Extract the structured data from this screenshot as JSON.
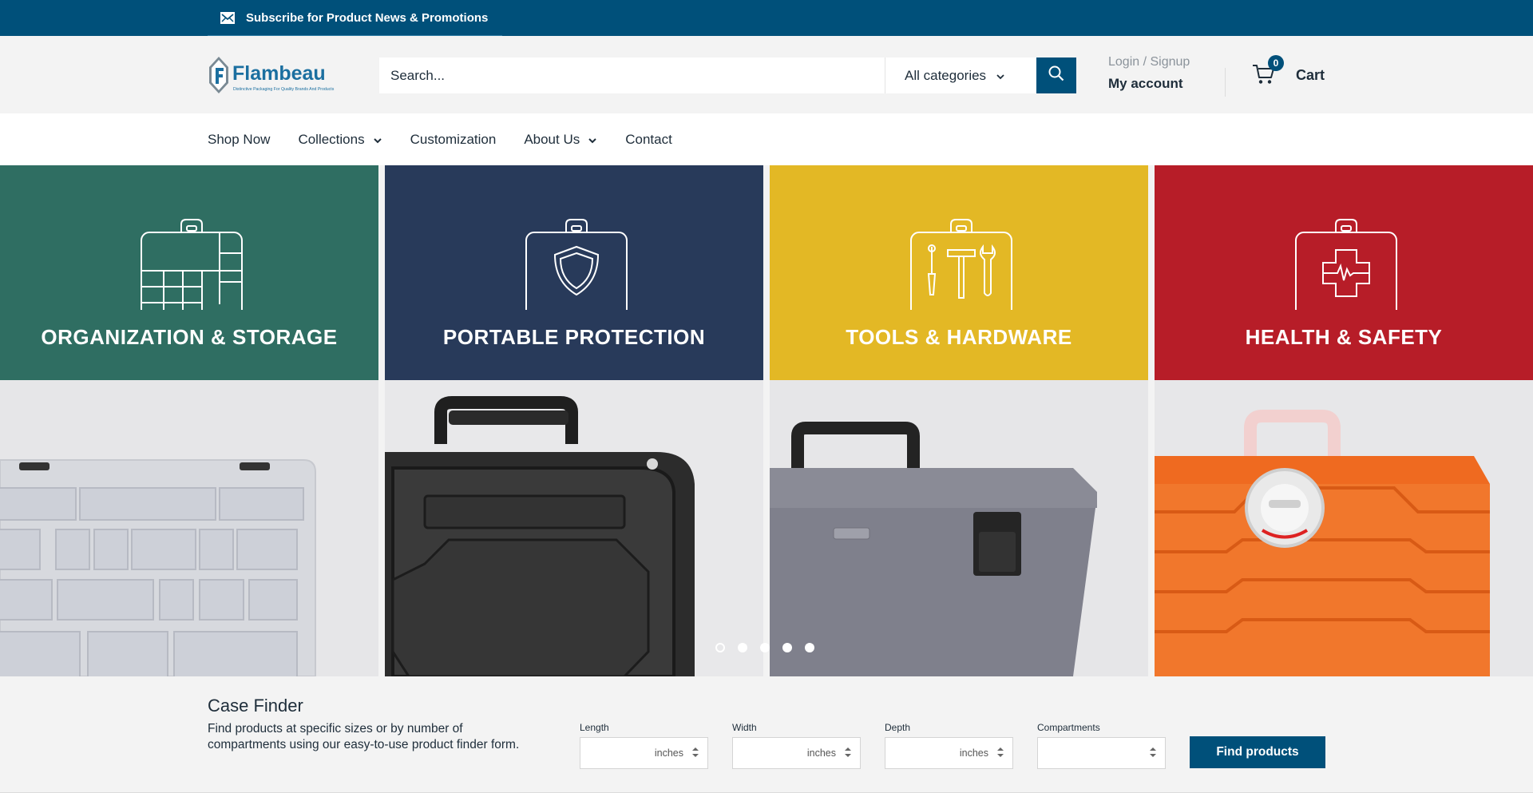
{
  "topbar": {
    "subscribe_label": "Subscribe for Product News & Promotions",
    "icon": "mail-icon"
  },
  "header": {
    "logo_text": "Flambeau",
    "logo_tagline": "Distinctive Packaging For Quality Brands And Products",
    "search_placeholder": "Search...",
    "category_select": "All categories",
    "login_label": "Login / Signup",
    "account_label": "My account",
    "cart_count": "0",
    "cart_label": "Cart"
  },
  "nav": {
    "items": [
      {
        "label": "Shop Now"
      },
      {
        "label": "Collections"
      },
      {
        "label": "Customization"
      },
      {
        "label": "About Us"
      },
      {
        "label": "Contact"
      }
    ]
  },
  "hero": {
    "tiles": [
      {
        "title": "ORGANIZATION & STORAGE",
        "color": "#2f6e62",
        "icon": "organizer-case-icon"
      },
      {
        "title": "PORTABLE PROTECTION",
        "color": "#283a5a",
        "icon": "shield-case-icon"
      },
      {
        "title": "TOOLS & HARDWARE",
        "color": "#e3b825",
        "icon": "tools-case-icon"
      },
      {
        "title": "HEALTH & SAFETY",
        "color": "#b71d28",
        "icon": "first-aid-case-icon"
      }
    ],
    "slide_count": 5,
    "active_slide": 1
  },
  "finder": {
    "title": "Case Finder",
    "description": "Find products at specific sizes or by number of compartments using our easy-to-use product finder form.",
    "fields": [
      {
        "label": "Length",
        "unit": "inches"
      },
      {
        "label": "Width",
        "unit": "inches"
      },
      {
        "label": "Depth",
        "unit": "inches"
      },
      {
        "label": "Compartments",
        "unit": ""
      }
    ],
    "submit_label": "Find products"
  },
  "colors": {
    "brand": "#00507a",
    "text": "#1e2d3a"
  }
}
